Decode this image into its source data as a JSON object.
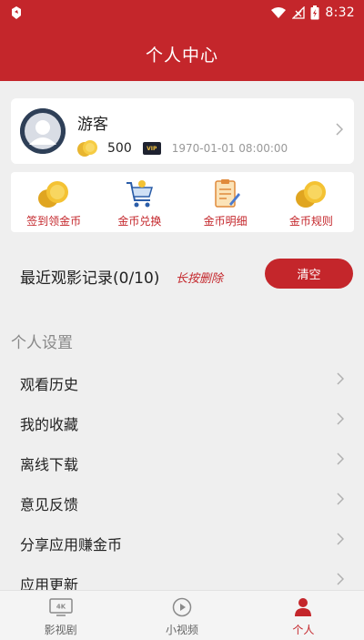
{
  "status_bar": {
    "time": "8:32"
  },
  "header": {
    "title": "个人中心"
  },
  "profile": {
    "username": "游客",
    "coins": "500",
    "vip_label": "VIP",
    "vip_expiry": "1970-01-01 08:00:00"
  },
  "actions": [
    {
      "label": "签到领金币",
      "icon": "coin-stack-icon"
    },
    {
      "label": "金币兑换",
      "icon": "shopping-cart-icon"
    },
    {
      "label": "金币明细",
      "icon": "clipboard-icon"
    },
    {
      "label": "金币规则",
      "icon": "coin-stack-icon"
    }
  ],
  "recent": {
    "title": "最近观影记录(0/10)",
    "hint": "长按删除",
    "clear_label": "清空"
  },
  "settings": {
    "title": "个人设置",
    "items": [
      {
        "label": "观看历史"
      },
      {
        "label": "我的收藏"
      },
      {
        "label": "离线下载"
      },
      {
        "label": "意见反馈"
      },
      {
        "label": "分享应用赚金币"
      },
      {
        "label": "应用更新"
      }
    ]
  },
  "bottom_nav": [
    {
      "label": "影视剧",
      "icon": "4k-tv-icon",
      "active": false
    },
    {
      "label": "小视频",
      "icon": "play-circle-icon",
      "active": false
    },
    {
      "label": "个人",
      "icon": "person-icon",
      "active": true
    }
  ],
  "colors": {
    "brand": "#c4262b",
    "background": "#efefef",
    "card": "#ffffff"
  }
}
